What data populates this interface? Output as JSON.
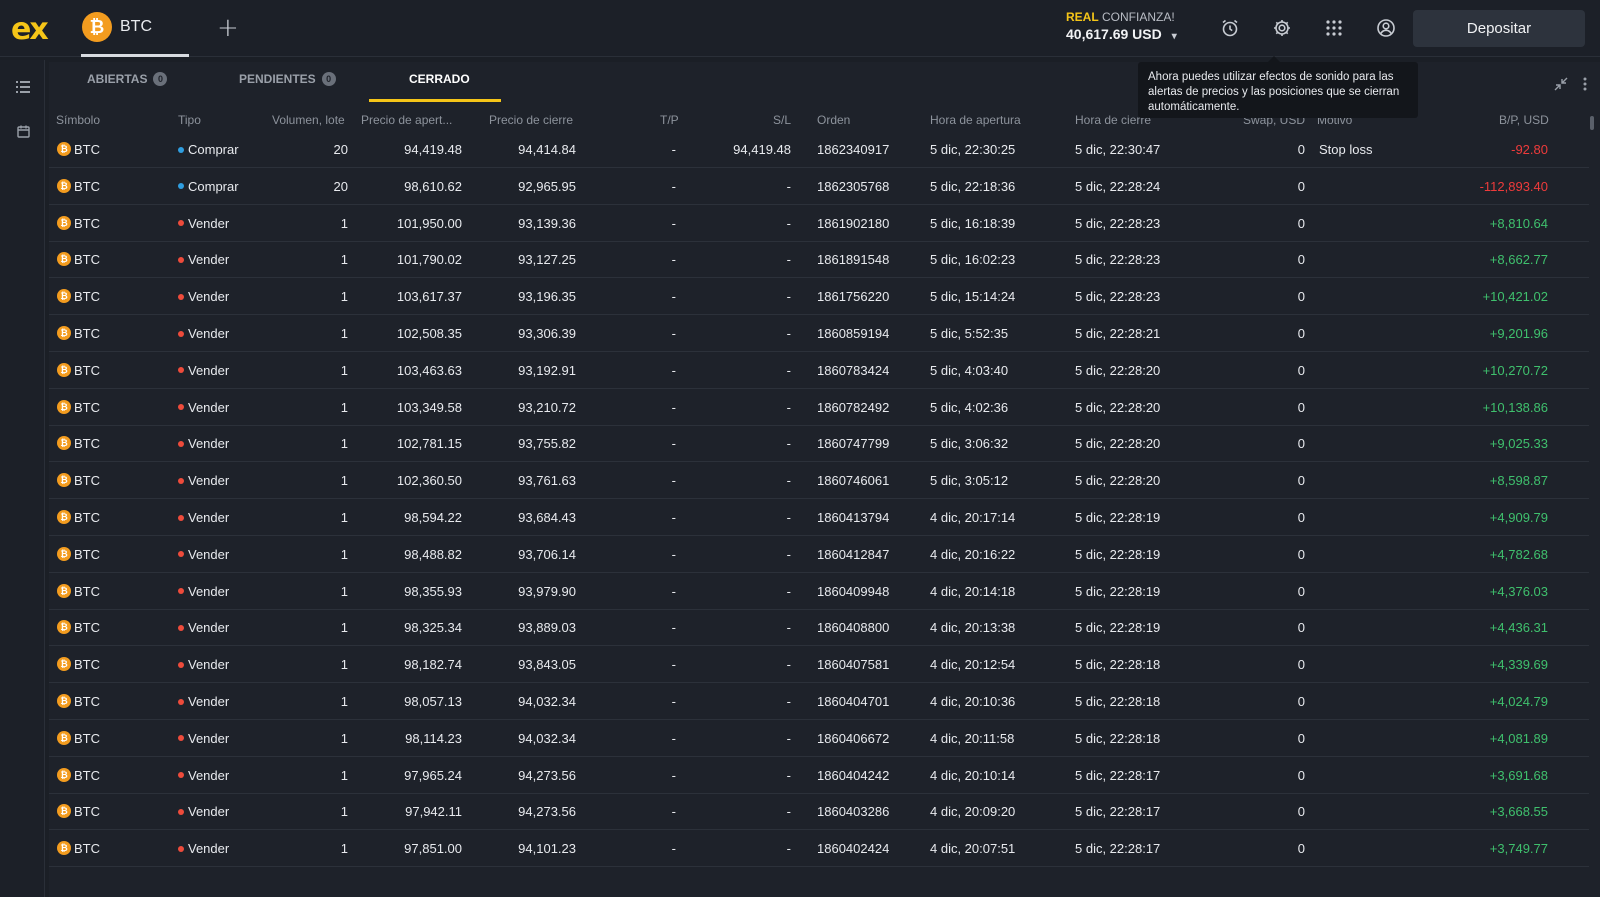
{
  "header": {
    "logo": "ex",
    "asset_tab": {
      "coin": "₿",
      "label": "BTC"
    },
    "add_tab": "+",
    "account": {
      "mode": "REAL",
      "name": "CONFIANZA!",
      "balance": "40,617.69 USD",
      "caret": "▾"
    },
    "icons": [
      "alarm-icon",
      "gear-icon",
      "apps-grid-icon",
      "account-icon"
    ],
    "deposit_label": "Depositar"
  },
  "sidebar": {
    "icons": [
      "list-icon",
      "calendar-icon"
    ]
  },
  "tabs": [
    {
      "label": "ABIERTAS",
      "badge": "0"
    },
    {
      "label": "PENDIENTES",
      "badge": "0"
    },
    {
      "label": "CERRADO",
      "badge": ""
    }
  ],
  "tooltip": "Ahora puedes utilizar efectos de sonido para las alertas de precios y las posiciones que se cierran automáticamente.",
  "columns": {
    "symbol": "Símbolo",
    "type": "Tipo",
    "volume": "Volumen, lote",
    "open_price": "Precio de apert...",
    "close_price": "Precio de cierre",
    "tp": "T/P",
    "sl": "S/L",
    "order": "Orden",
    "open_time": "Hora de apertura",
    "close_time": "Hora de cierre",
    "swap": "Swap, USD",
    "reason": "Motivo",
    "pl": "B/P, USD"
  },
  "colors": {
    "buy": "#2f9ee0",
    "sell": "#ee4b3b",
    "profit": "#3fc06d",
    "loss": "#ee3b3b",
    "accent": "#f5c518"
  },
  "rows": [
    {
      "symbol": "BTC",
      "type": "Comprar",
      "side": "buy",
      "volume": "20",
      "open_price": "94,419.48",
      "close_price": "94,414.84",
      "tp": "-",
      "sl": "94,419.48",
      "order": "1862340917",
      "open_time": "5 dic, 22:30:25",
      "close_time": "5 dic, 22:30:47",
      "swap": "0",
      "reason": "Stop loss",
      "pl": "-92.80"
    },
    {
      "symbol": "BTC",
      "type": "Comprar",
      "side": "buy",
      "volume": "20",
      "open_price": "98,610.62",
      "close_price": "92,965.95",
      "tp": "-",
      "sl": "-",
      "order": "1862305768",
      "open_time": "5 dic, 22:18:36",
      "close_time": "5 dic, 22:28:24",
      "swap": "0",
      "reason": "",
      "pl": "-112,893.40"
    },
    {
      "symbol": "BTC",
      "type": "Vender",
      "side": "sell",
      "volume": "1",
      "open_price": "101,950.00",
      "close_price": "93,139.36",
      "tp": "-",
      "sl": "-",
      "order": "1861902180",
      "open_time": "5 dic, 16:18:39",
      "close_time": "5 dic, 22:28:23",
      "swap": "0",
      "reason": "",
      "pl": "+8,810.64"
    },
    {
      "symbol": "BTC",
      "type": "Vender",
      "side": "sell",
      "volume": "1",
      "open_price": "101,790.02",
      "close_price": "93,127.25",
      "tp": "-",
      "sl": "-",
      "order": "1861891548",
      "open_time": "5 dic, 16:02:23",
      "close_time": "5 dic, 22:28:23",
      "swap": "0",
      "reason": "",
      "pl": "+8,662.77"
    },
    {
      "symbol": "BTC",
      "type": "Vender",
      "side": "sell",
      "volume": "1",
      "open_price": "103,617.37",
      "close_price": "93,196.35",
      "tp": "-",
      "sl": "-",
      "order": "1861756220",
      "open_time": "5 dic, 15:14:24",
      "close_time": "5 dic, 22:28:23",
      "swap": "0",
      "reason": "",
      "pl": "+10,421.02"
    },
    {
      "symbol": "BTC",
      "type": "Vender",
      "side": "sell",
      "volume": "1",
      "open_price": "102,508.35",
      "close_price": "93,306.39",
      "tp": "-",
      "sl": "-",
      "order": "1860859194",
      "open_time": "5 dic, 5:52:35",
      "close_time": "5 dic, 22:28:21",
      "swap": "0",
      "reason": "",
      "pl": "+9,201.96"
    },
    {
      "symbol": "BTC",
      "type": "Vender",
      "side": "sell",
      "volume": "1",
      "open_price": "103,463.63",
      "close_price": "93,192.91",
      "tp": "-",
      "sl": "-",
      "order": "1860783424",
      "open_time": "5 dic, 4:03:40",
      "close_time": "5 dic, 22:28:20",
      "swap": "0",
      "reason": "",
      "pl": "+10,270.72"
    },
    {
      "symbol": "BTC",
      "type": "Vender",
      "side": "sell",
      "volume": "1",
      "open_price": "103,349.58",
      "close_price": "93,210.72",
      "tp": "-",
      "sl": "-",
      "order": "1860782492",
      "open_time": "5 dic, 4:02:36",
      "close_time": "5 dic, 22:28:20",
      "swap": "0",
      "reason": "",
      "pl": "+10,138.86"
    },
    {
      "symbol": "BTC",
      "type": "Vender",
      "side": "sell",
      "volume": "1",
      "open_price": "102,781.15",
      "close_price": "93,755.82",
      "tp": "-",
      "sl": "-",
      "order": "1860747799",
      "open_time": "5 dic, 3:06:32",
      "close_time": "5 dic, 22:28:20",
      "swap": "0",
      "reason": "",
      "pl": "+9,025.33"
    },
    {
      "symbol": "BTC",
      "type": "Vender",
      "side": "sell",
      "volume": "1",
      "open_price": "102,360.50",
      "close_price": "93,761.63",
      "tp": "-",
      "sl": "-",
      "order": "1860746061",
      "open_time": "5 dic, 3:05:12",
      "close_time": "5 dic, 22:28:20",
      "swap": "0",
      "reason": "",
      "pl": "+8,598.87"
    },
    {
      "symbol": "BTC",
      "type": "Vender",
      "side": "sell",
      "volume": "1",
      "open_price": "98,594.22",
      "close_price": "93,684.43",
      "tp": "-",
      "sl": "-",
      "order": "1860413794",
      "open_time": "4 dic, 20:17:14",
      "close_time": "5 dic, 22:28:19",
      "swap": "0",
      "reason": "",
      "pl": "+4,909.79"
    },
    {
      "symbol": "BTC",
      "type": "Vender",
      "side": "sell",
      "volume": "1",
      "open_price": "98,488.82",
      "close_price": "93,706.14",
      "tp": "-",
      "sl": "-",
      "order": "1860412847",
      "open_time": "4 dic, 20:16:22",
      "close_time": "5 dic, 22:28:19",
      "swap": "0",
      "reason": "",
      "pl": "+4,782.68"
    },
    {
      "symbol": "BTC",
      "type": "Vender",
      "side": "sell",
      "volume": "1",
      "open_price": "98,355.93",
      "close_price": "93,979.90",
      "tp": "-",
      "sl": "-",
      "order": "1860409948",
      "open_time": "4 dic, 20:14:18",
      "close_time": "5 dic, 22:28:19",
      "swap": "0",
      "reason": "",
      "pl": "+4,376.03"
    },
    {
      "symbol": "BTC",
      "type": "Vender",
      "side": "sell",
      "volume": "1",
      "open_price": "98,325.34",
      "close_price": "93,889.03",
      "tp": "-",
      "sl": "-",
      "order": "1860408800",
      "open_time": "4 dic, 20:13:38",
      "close_time": "5 dic, 22:28:19",
      "swap": "0",
      "reason": "",
      "pl": "+4,436.31"
    },
    {
      "symbol": "BTC",
      "type": "Vender",
      "side": "sell",
      "volume": "1",
      "open_price": "98,182.74",
      "close_price": "93,843.05",
      "tp": "-",
      "sl": "-",
      "order": "1860407581",
      "open_time": "4 dic, 20:12:54",
      "close_time": "5 dic, 22:28:18",
      "swap": "0",
      "reason": "",
      "pl": "+4,339.69"
    },
    {
      "symbol": "BTC",
      "type": "Vender",
      "side": "sell",
      "volume": "1",
      "open_price": "98,057.13",
      "close_price": "94,032.34",
      "tp": "-",
      "sl": "-",
      "order": "1860404701",
      "open_time": "4 dic, 20:10:36",
      "close_time": "5 dic, 22:28:18",
      "swap": "0",
      "reason": "",
      "pl": "+4,024.79"
    },
    {
      "symbol": "BTC",
      "type": "Vender",
      "side": "sell",
      "volume": "1",
      "open_price": "98,114.23",
      "close_price": "94,032.34",
      "tp": "-",
      "sl": "-",
      "order": "1860406672",
      "open_time": "4 dic, 20:11:58",
      "close_time": "5 dic, 22:28:18",
      "swap": "0",
      "reason": "",
      "pl": "+4,081.89"
    },
    {
      "symbol": "BTC",
      "type": "Vender",
      "side": "sell",
      "volume": "1",
      "open_price": "97,965.24",
      "close_price": "94,273.56",
      "tp": "-",
      "sl": "-",
      "order": "1860404242",
      "open_time": "4 dic, 20:10:14",
      "close_time": "5 dic, 22:28:17",
      "swap": "0",
      "reason": "",
      "pl": "+3,691.68"
    },
    {
      "symbol": "BTC",
      "type": "Vender",
      "side": "sell",
      "volume": "1",
      "open_price": "97,942.11",
      "close_price": "94,273.56",
      "tp": "-",
      "sl": "-",
      "order": "1860403286",
      "open_time": "4 dic, 20:09:20",
      "close_time": "5 dic, 22:28:17",
      "swap": "0",
      "reason": "",
      "pl": "+3,668.55"
    },
    {
      "symbol": "BTC",
      "type": "Vender",
      "side": "sell",
      "volume": "1",
      "open_price": "97,851.00",
      "close_price": "94,101.23",
      "tp": "-",
      "sl": "-",
      "order": "1860402424",
      "open_time": "4 dic, 20:07:51",
      "close_time": "5 dic, 22:28:17",
      "swap": "0",
      "reason": "",
      "pl": "+3,749.77"
    }
  ]
}
